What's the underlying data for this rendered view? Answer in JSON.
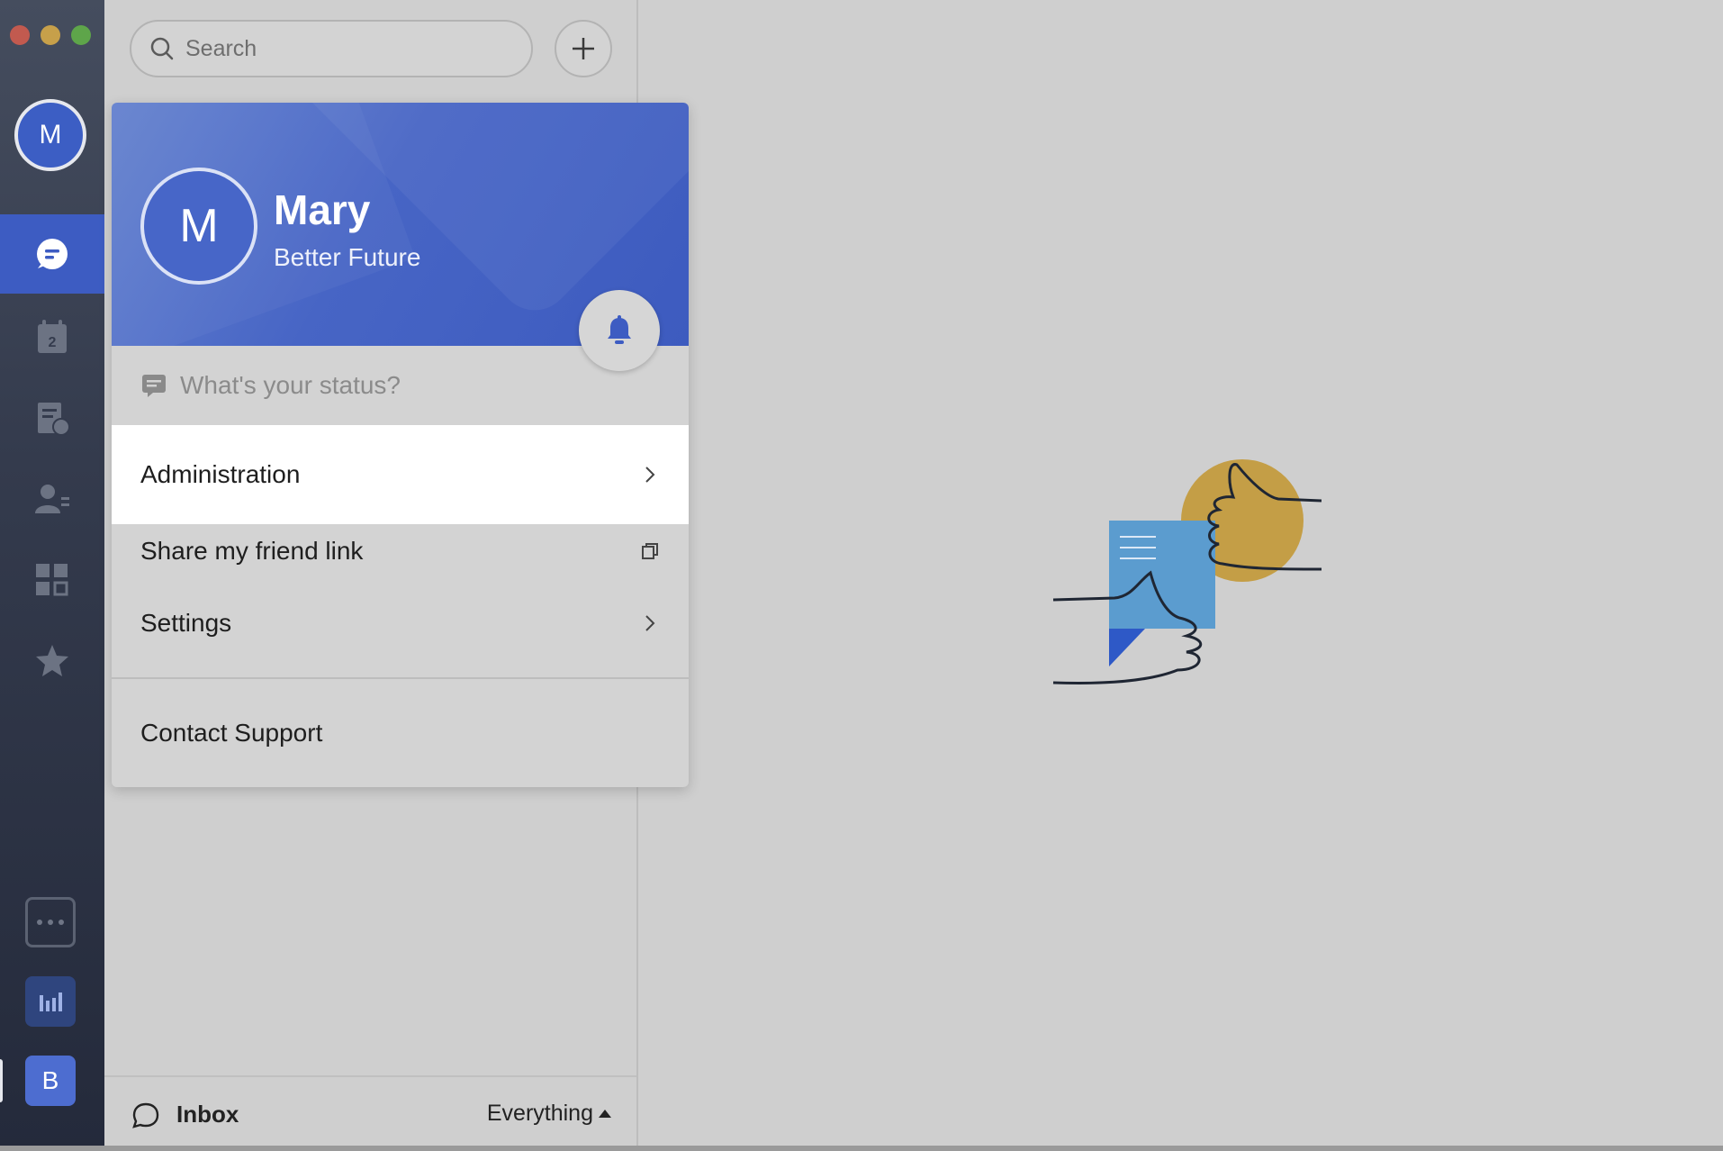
{
  "window": {
    "traffic_lights": [
      "close",
      "minimize",
      "zoom"
    ],
    "colors": {
      "close": "#c25a4f",
      "minimize": "#c7a04a",
      "zoom": "#5ea54a"
    }
  },
  "rail": {
    "avatar_initial": "M",
    "items": [
      {
        "name": "chat-icon",
        "active": true
      },
      {
        "name": "calendar-icon",
        "badge": "2"
      },
      {
        "name": "tasks-icon"
      },
      {
        "name": "contacts-icon"
      },
      {
        "name": "apps-grid-icon"
      },
      {
        "name": "star-icon"
      }
    ],
    "workspace_initial": "B",
    "accent": "#3d5cc2"
  },
  "search": {
    "placeholder": "Search"
  },
  "profile_menu": {
    "avatar_initial": "M",
    "name": "Mary",
    "organization": "Better Future",
    "status_placeholder": "What's your status?",
    "items": [
      {
        "label": "Administration"
      },
      {
        "label": "Share my friend link"
      },
      {
        "label": "Settings"
      },
      {
        "label": "Contact Support"
      }
    ]
  },
  "footer": {
    "inbox_label": "Inbox",
    "filter_label": "Everything"
  }
}
